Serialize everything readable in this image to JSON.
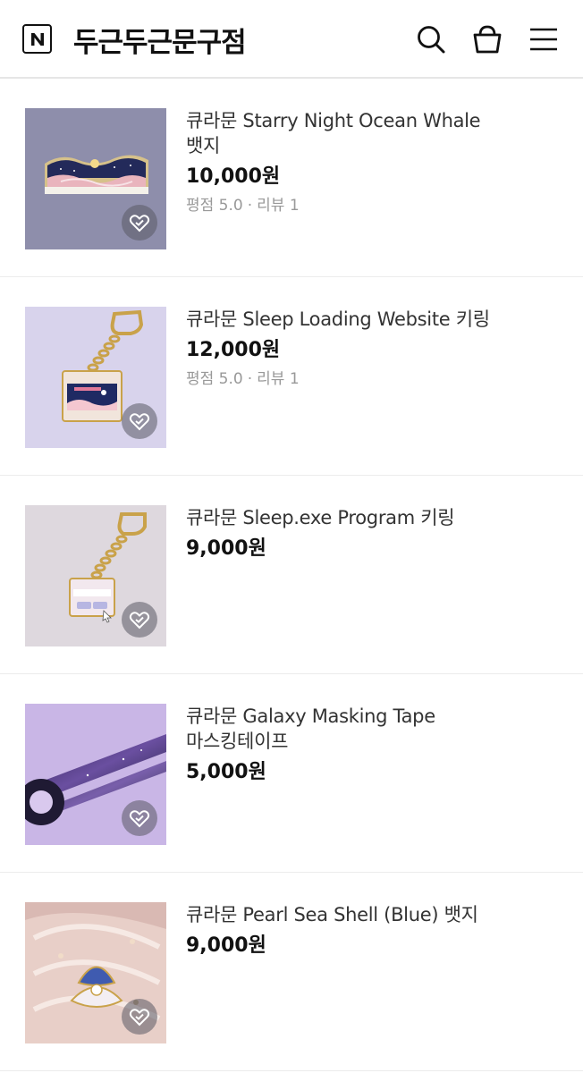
{
  "header": {
    "logo_letter": "N",
    "store_name": "두근두근문구점",
    "icons": [
      "search-icon",
      "shopping-bag-icon",
      "menu-icon"
    ]
  },
  "colors": {
    "price": "#111111",
    "meta": "#999999",
    "divider": "#ececec"
  },
  "products": [
    {
      "name": "큐라문 Starry Night Ocean Whale 뱃지",
      "price": "10,000원",
      "rating_label": "평점 5.0",
      "review_label": "리뷰 1"
    },
    {
      "name": "큐라문 Sleep Loading Website 키링",
      "price": "12,000원",
      "rating_label": "평점 5.0",
      "review_label": "리뷰 1"
    },
    {
      "name": "큐라문 Sleep.exe Program 키링",
      "price": "9,000원"
    },
    {
      "name": "큐라문 Galaxy Masking Tape 마스킹테이프",
      "price": "5,000원"
    },
    {
      "name": "큐라문 Pearl Sea Shell (Blue) 뱃지",
      "price": "9,000원"
    }
  ]
}
